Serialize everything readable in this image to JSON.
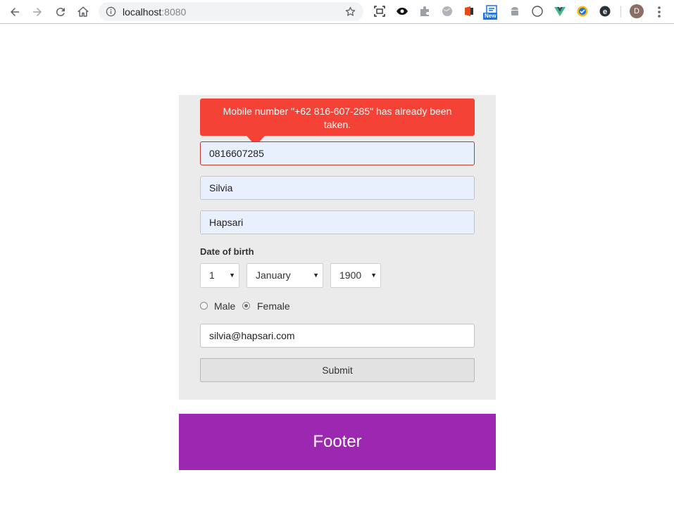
{
  "browser": {
    "url_host": "localhost",
    "url_port": ":8080",
    "ext_new_badge": "New",
    "avatar_letter": "D"
  },
  "form": {
    "error_message": "Mobile number \"+62 816-607-285\" has already been taken.",
    "mobile_value": "0816607285",
    "first_name_value": "Silvia",
    "last_name_value": "Hapsari",
    "dob_label": "Date of birth",
    "dob_day": "1",
    "dob_month": "January",
    "dob_year": "1900",
    "gender_options": [
      "Male",
      "Female"
    ],
    "gender_selected": "Female",
    "email_value": "silvia@hapsari.com",
    "submit_label": "Submit"
  },
  "footer": {
    "label": "Footer"
  },
  "colors": {
    "error": "#f44336",
    "footer": "#9c27b0",
    "panel": "#ebebeb",
    "autofill": "#e8f0fe"
  }
}
